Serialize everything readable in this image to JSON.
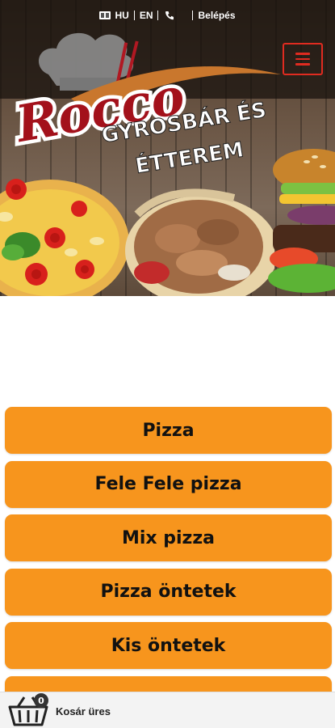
{
  "header": {
    "languages": [
      "HU",
      "EN"
    ],
    "login_label": "Belépés",
    "menu_icon": "hamburger-icon",
    "accent_color": "#e02b20"
  },
  "hero": {
    "logo_text": "Rocco",
    "tagline_line1": "GYROSBÁR ÉS",
    "tagline_line2": "ÉTTEREM"
  },
  "categories": [
    {
      "label": "Pizza"
    },
    {
      "label": "Fele Fele pizza"
    },
    {
      "label": "Mix pizza"
    },
    {
      "label": "Pizza öntetek"
    },
    {
      "label": "Kis öntetek"
    }
  ],
  "category_color": "#f7951d",
  "cart": {
    "status": "Kosár üres",
    "count": "0",
    "icon": "shopping-basket-icon"
  }
}
